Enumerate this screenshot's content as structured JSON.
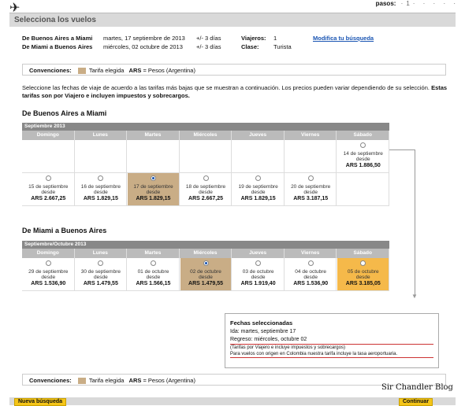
{
  "topbar": {
    "steps_label": "pasos:",
    "steps_dots": "·1· · · · ·"
  },
  "header": {
    "title": "Selecciona los vuelos"
  },
  "summary": {
    "leg1_route": "De Buenos Aires a Miami",
    "leg1_date": "martes, 17 septiembre de 2013",
    "leg1_flex": "+/- 3 días",
    "leg2_route": "De Miami a Buenos Aires",
    "leg2_date": "miércoles, 02 octubre de 2013",
    "leg2_flex": "+/- 3 días",
    "travelers_label": "Viajeros:",
    "travelers_value": "1",
    "class_label": "Clase:",
    "class_value": "Turista",
    "modify_link": "Modifica tu búsqueda"
  },
  "conventions": {
    "label": "Convenciones:",
    "chosen": "Tarifa elegida",
    "currency_code": "ARS",
    "currency_desc": "= Pesos (Argentina)"
  },
  "intro": {
    "text": "Seleccione las fechas de viaje de acuerdo a las tarifas más bajas que se muestran a continuación. Los precios pueden variar dependiendo de su selección.",
    "bold": "Estas tarifas son por Viajero e incluyen impuestos y sobrecargos."
  },
  "outbound": {
    "title": "De Buenos Aires a Miami",
    "month": "Septiembre 2013",
    "days": [
      "Domingo",
      "Lunes",
      "Martes",
      "Miércoles",
      "Jueves",
      "Viernes",
      "Sábado"
    ],
    "week1": [
      null,
      null,
      null,
      null,
      null,
      null,
      {
        "date": "14 de septiembre",
        "desde": "desde",
        "price": "ARS 1.886,50"
      }
    ],
    "week2": [
      {
        "date": "15 de septiembre",
        "desde": "desde",
        "price": "ARS 2.667,25"
      },
      {
        "date": "16 de septiembre",
        "desde": "desde",
        "price": "ARS 1.829,15"
      },
      {
        "date": "17 de septiembre",
        "desde": "desde",
        "price": "ARS 1.829,15"
      },
      {
        "date": "18 de septiembre",
        "desde": "desde",
        "price": "ARS 2.667,25"
      },
      {
        "date": "19 de septiembre",
        "desde": "desde",
        "price": "ARS 1.829,15"
      },
      {
        "date": "20 de septiembre",
        "desde": "desde",
        "price": "ARS 3.187,15"
      }
    ]
  },
  "inbound": {
    "title": "De Miami a Buenos Aires",
    "month": "Septiembre/Octubre 2013",
    "days": [
      "Domingo",
      "Lunes",
      "Martes",
      "Miércoles",
      "Jueves",
      "Viernes",
      "Sábado"
    ],
    "week1": [
      {
        "date": "29 de septiembre",
        "desde": "desde",
        "price": "ARS 1.536,90"
      },
      {
        "date": "30 de septiembre",
        "desde": "desde",
        "price": "ARS 1.479,55"
      },
      {
        "date": "01 de octubre",
        "desde": "desde",
        "price": "ARS 1.566,15"
      },
      {
        "date": "02 de octubre",
        "desde": "desde",
        "price": "ARS 1.479,55"
      },
      {
        "date": "03 de octubre",
        "desde": "desde",
        "price": "ARS 1.919,40"
      },
      {
        "date": "04 de octubre",
        "desde": "desde",
        "price": "ARS 1.536,90"
      },
      {
        "date": "05 de octubre",
        "desde": "desde",
        "price": "ARS 3.185,05"
      }
    ]
  },
  "selected": {
    "title": "Fechas seleccionadas",
    "ida": "Ida: martes, septiembre 17",
    "regreso": "Regreso: miércoles, octubre 02",
    "note1": "(Tarifas por Viajero e incluye impuestos y sobrecargos)",
    "note2": "Para vuelos con origen en Colombia nuestra tarifa incluye la tasa aeroportuaria."
  },
  "buttons": {
    "new_search": "Nueva búsqueda",
    "continue": "Continuar"
  },
  "watermark": "Sir Chandler Blog"
}
